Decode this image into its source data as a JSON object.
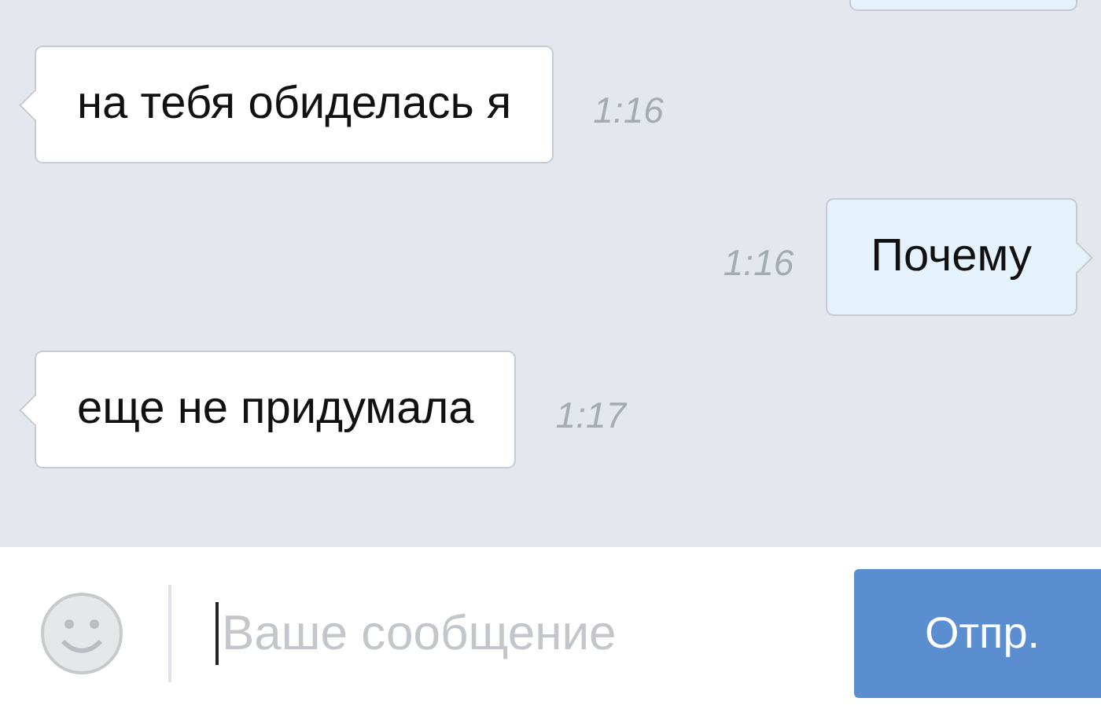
{
  "messages": [
    {
      "kind": "outgoing"
    },
    {
      "kind": "incoming",
      "text": "на тебя обиделась я",
      "time": "1:16"
    },
    {
      "kind": "outgoing",
      "text": "Почему",
      "time": "1:16"
    },
    {
      "kind": "incoming",
      "text": "еще не придумала",
      "time": "1:17"
    }
  ],
  "composer": {
    "placeholder": "Ваше сообщение",
    "send_label": "Отпр."
  }
}
